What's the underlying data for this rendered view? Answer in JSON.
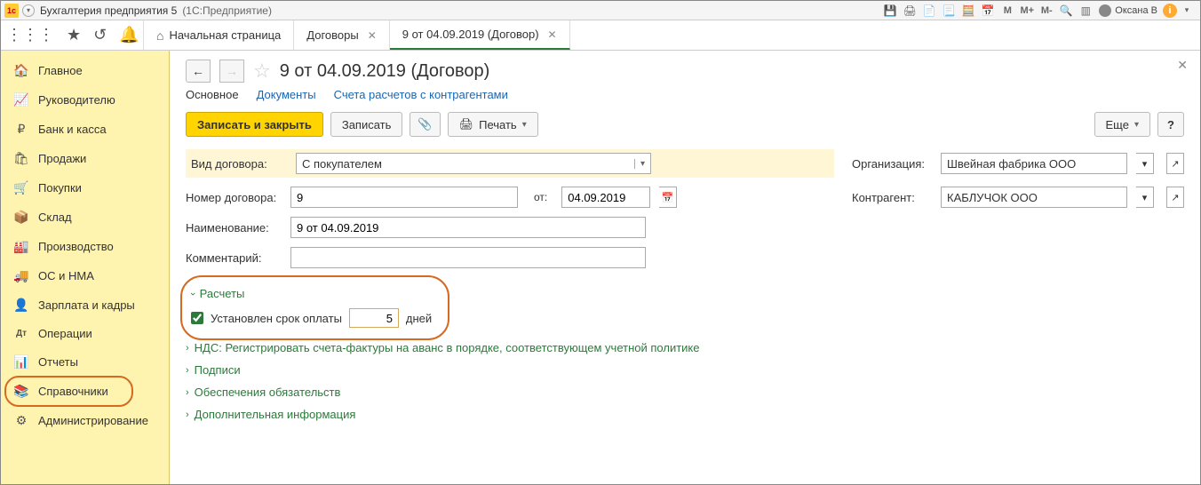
{
  "titlebar": {
    "app": "Бухгалтерия предприятия 5",
    "suffix": "(1С:Предприятие)",
    "mem": [
      "M",
      "M+",
      "M-"
    ],
    "user": "Оксана В"
  },
  "tabs": {
    "home": "Начальная страница",
    "t1": "Договоры",
    "t2": "9 от 04.09.2019 (Договор)"
  },
  "sidebar": [
    {
      "icon": "🏠",
      "label": "Главное"
    },
    {
      "icon": "📈",
      "label": "Руководителю"
    },
    {
      "icon": "₽",
      "label": "Банк и касса"
    },
    {
      "icon": "🛍",
      "label": "Продажи"
    },
    {
      "icon": "🛒",
      "label": "Покупки"
    },
    {
      "icon": "📦",
      "label": "Склад"
    },
    {
      "icon": "🏭",
      "label": "Производство"
    },
    {
      "icon": "🚚",
      "label": "ОС и НМА"
    },
    {
      "icon": "👤",
      "label": "Зарплата и кадры"
    },
    {
      "icon": "Дт",
      "label": "Операции"
    },
    {
      "icon": "📊",
      "label": "Отчеты"
    },
    {
      "icon": "📚",
      "label": "Справочники"
    },
    {
      "icon": "⚙",
      "label": "Администрирование"
    }
  ],
  "page": {
    "title": "9 от 04.09.2019 (Договор)",
    "subtabs": {
      "main": "Основное",
      "docs": "Документы",
      "accounts": "Счета расчетов с контрагентами"
    },
    "buttons": {
      "saveclose": "Записать и закрыть",
      "save": "Записать",
      "print": "Печать",
      "more": "Еще",
      "help": "?"
    },
    "fields": {
      "vidLabel": "Вид договора:",
      "vidValue": "С покупателем",
      "numLabel": "Номер договора:",
      "numValue": "9",
      "ot": "от:",
      "date": "04.09.2019",
      "nameLabel": "Наименование:",
      "nameValue": "9 от 04.09.2019",
      "commentLabel": "Комментарий:",
      "commentValue": "",
      "orgLabel": "Организация:",
      "orgValue": "Швейная фабрика ООО",
      "contrLabel": "Контрагент:",
      "contrValue": "КАБЛУЧОК ООО"
    },
    "sections": {
      "raschety": "Расчеты",
      "payCheck": "Установлен срок оплаты",
      "payDays": "5",
      "daysLabel": "дней",
      "nds": "НДС: Регистрировать счета-фактуры на аванс в порядке, соответствующем учетной политике",
      "podpisi": "Подписи",
      "obesp": "Обеспечения обязательств",
      "dopinfo": "Дополнительная информация"
    }
  }
}
